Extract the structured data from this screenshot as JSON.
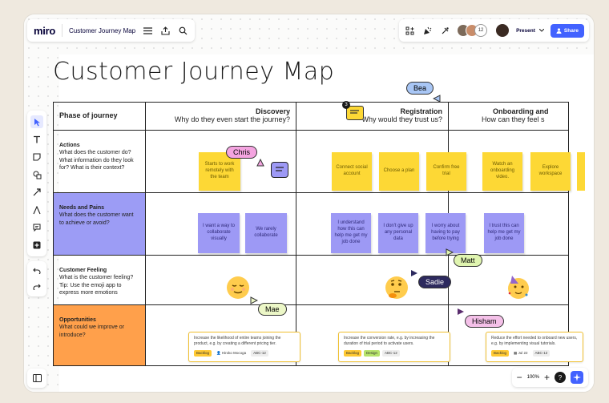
{
  "app": {
    "logo": "miro",
    "board_name": "Customer Journey Map"
  },
  "header": {
    "avatar_count": "12",
    "present_label": "Present",
    "share_label": "Share"
  },
  "board": {
    "title": "Customer Journey Map"
  },
  "table": {
    "phase_label": "Phase of journey",
    "stages": [
      {
        "title": "Discovery",
        "subtitle": "Why do they even start the journey?"
      },
      {
        "title": "Registration",
        "subtitle": "Why would they trust us?"
      },
      {
        "title": "Onboarding and",
        "subtitle": "How can they feel s"
      }
    ],
    "rows": [
      {
        "title": "Actions",
        "desc": "What does the customer do? What information do they look for? What is their context?"
      },
      {
        "title": "Needs and Pains",
        "desc": "What does the customer want to achieve or avoid?"
      },
      {
        "title": "Customer Feeling",
        "desc": "What is the customer feeling? Tip: Use the emoji app to express more emotions"
      },
      {
        "title": "Opportunities",
        "desc": "What could we improve or introduce?"
      }
    ]
  },
  "stickies": {
    "a1": "Starts to work remotely with the team",
    "a2": "Connect social account",
    "a3": "Choose a plan",
    "a4": "Confirm free trial",
    "a5": "Watch an onboarding video.",
    "a6": "Explore workspace",
    "n1": "I want a way to collaborate visually",
    "n2": "We rarely collaborate",
    "n3": "I understand how this can help me get my job done",
    "n4": "I don't give up any personal data",
    "n5": "I worry about having to pay before trying",
    "n6": "I trust this can help me get my job done"
  },
  "opportunities": {
    "o1": {
      "text": "Increase the likelihood of entire teams joining the product, e.g. by creating a different pricing tier.",
      "tag1": "Backlog",
      "user": "Hiroko Mocoga",
      "id": "ABC-12"
    },
    "o2": {
      "text": "Increase the conversion rate, e.g. by increasing the duration of trial period to activate users.",
      "tag1": "Backlog",
      "tag2": "Design",
      "id": "ABC-12"
    },
    "o3": {
      "text": "Reduce the effort needed to onboard new users, e.g. by implementing visual tutorials.",
      "tag1": "Backlog",
      "date": "Jul 22",
      "id": "ABC-12"
    }
  },
  "cursors": {
    "bea": "Bea",
    "chris": "Chris",
    "matt": "Matt",
    "sadie": "Sadie",
    "mae": "Mae",
    "hisham": "Hisham"
  },
  "comment_count": "3",
  "zoom": {
    "level": "100%"
  },
  "colors": {
    "accent": "#4262ff",
    "yellow_sticky": "#fdd835",
    "lavender_sticky": "#9d99f5",
    "purple_cell": "#9c9cf5",
    "orange_cell": "#ffa04b"
  }
}
